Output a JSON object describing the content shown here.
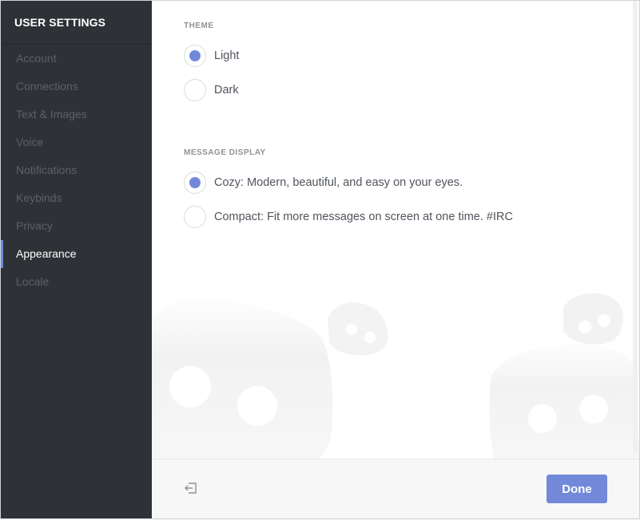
{
  "sidebar": {
    "title": "USER SETTINGS",
    "items": [
      {
        "label": "Account"
      },
      {
        "label": "Connections"
      },
      {
        "label": "Text & Images"
      },
      {
        "label": "Voice"
      },
      {
        "label": "Notifications"
      },
      {
        "label": "Keybinds"
      },
      {
        "label": "Privacy"
      },
      {
        "label": "Appearance",
        "active": true
      },
      {
        "label": "Locale"
      }
    ]
  },
  "theme": {
    "title": "THEME",
    "options": [
      {
        "label": "Light",
        "selected": true
      },
      {
        "label": "Dark",
        "selected": false
      }
    ]
  },
  "message_display": {
    "title": "MESSAGE DISPLAY",
    "options": [
      {
        "label": "Cozy: Modern, beautiful, and easy on your eyes.",
        "selected": true
      },
      {
        "label": "Compact: Fit more messages on screen at one time. #IRC",
        "selected": false
      }
    ]
  },
  "footer": {
    "done_label": "Done",
    "logout_icon": "logout-icon"
  },
  "colors": {
    "accent": "#7289da",
    "sidebar_bg": "#2e3136"
  }
}
